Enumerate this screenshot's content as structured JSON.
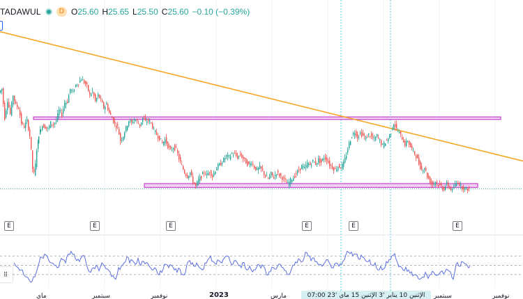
{
  "legend": {
    "symbol": "TADAWUL",
    "interval_badge": "D",
    "open_label": "O",
    "open": "25.60",
    "high_label": "H",
    "high": "25.65",
    "low_label": "L",
    "low": "25.50",
    "close_label": "C",
    "close": "25.60",
    "change": "−0.10 (−0.39%)"
  },
  "colors": {
    "up": "#26a69a",
    "down": "#ef5350",
    "trendline": "#f5a623",
    "zone_border": "#c442c8",
    "zone_fill": "#f3d0f5",
    "oscillator": "#5b6ee1",
    "crosshair": "#4dd0e1"
  },
  "earnings_badge_text": "E",
  "x_axis": {
    "labels": [
      "ماي",
      "سبتمبر",
      "نوفمبر",
      "2023",
      "مارس",
      "سبتمبر",
      "نوفمبر"
    ],
    "bold_label": "2023",
    "cursor_date": "الإثنين 10 يناير '3  الإثنين 15 ماي '23  07:00"
  },
  "chart_data": {
    "type": "candlestick",
    "symbol": "TADAWUL",
    "interval": "D",
    "last_bar": {
      "open": 25.6,
      "high": 25.65,
      "low": 25.5,
      "close": 25.6,
      "change": -0.1,
      "change_pct": -0.39
    },
    "price_path": [
      [
        0,
        33.2
      ],
      [
        4,
        33.5
      ],
      [
        8,
        31.2
      ],
      [
        12,
        32.6
      ],
      [
        16,
        31.5
      ],
      [
        20,
        33.0
      ],
      [
        24,
        32.2
      ],
      [
        28,
        32.0
      ],
      [
        32,
        30.8
      ],
      [
        36,
        30.5
      ],
      [
        40,
        31.0
      ],
      [
        44,
        29.8
      ],
      [
        46,
        28.6
      ],
      [
        48,
        27.2
      ],
      [
        50,
        26.8
      ],
      [
        52,
        27.5
      ],
      [
        55,
        29.3
      ],
      [
        58,
        30.2
      ],
      [
        62,
        30.6
      ],
      [
        66,
        30.5
      ],
      [
        70,
        30.3
      ],
      [
        74,
        30.8
      ],
      [
        78,
        30.7
      ],
      [
        82,
        31.0
      ],
      [
        86,
        31.8
      ],
      [
        90,
        31.5
      ],
      [
        94,
        32.4
      ],
      [
        98,
        32.5
      ],
      [
        102,
        33.5
      ],
      [
        106,
        33.2
      ],
      [
        110,
        33.8
      ],
      [
        114,
        34.0
      ],
      [
        118,
        34.3
      ],
      [
        122,
        34.0
      ],
      [
        126,
        33.7
      ],
      [
        130,
        33.0
      ],
      [
        134,
        33.3
      ],
      [
        138,
        32.5
      ],
      [
        142,
        33.0
      ],
      [
        146,
        32.6
      ],
      [
        150,
        32.0
      ],
      [
        154,
        32.3
      ],
      [
        158,
        31.6
      ],
      [
        162,
        31.2
      ],
      [
        166,
        30.7
      ],
      [
        170,
        30.5
      ],
      [
        174,
        29.4
      ],
      [
        178,
        29.8
      ],
      [
        182,
        30.4
      ],
      [
        186,
        31.0
      ],
      [
        190,
        30.8
      ],
      [
        194,
        31.1
      ],
      [
        198,
        30.9
      ],
      [
        202,
        30.6
      ],
      [
        206,
        31.2
      ],
      [
        210,
        30.9
      ],
      [
        214,
        31.0
      ],
      [
        218,
        30.8
      ],
      [
        222,
        30.2
      ],
      [
        226,
        29.9
      ],
      [
        230,
        29.6
      ],
      [
        234,
        29.2
      ],
      [
        238,
        29.5
      ],
      [
        242,
        29.0
      ],
      [
        246,
        28.6
      ],
      [
        250,
        28.9
      ],
      [
        254,
        28.7
      ],
      [
        258,
        28.0
      ],
      [
        262,
        27.4
      ],
      [
        266,
        26.9
      ],
      [
        270,
        26.6
      ],
      [
        274,
        26.9
      ],
      [
        278,
        26.2
      ],
      [
        282,
        25.8
      ],
      [
        286,
        26.3
      ],
      [
        290,
        26.6
      ],
      [
        294,
        26.9
      ],
      [
        298,
        26.7
      ],
      [
        302,
        27.0
      ],
      [
        306,
        26.6
      ],
      [
        310,
        27.1
      ],
      [
        314,
        27.4
      ],
      [
        318,
        27.6
      ],
      [
        322,
        27.9
      ],
      [
        326,
        28.2
      ],
      [
        330,
        28.1
      ],
      [
        334,
        28.4
      ],
      [
        338,
        28.3
      ],
      [
        342,
        28.1
      ],
      [
        346,
        28.3
      ],
      [
        350,
        28.0
      ],
      [
        354,
        27.7
      ],
      [
        358,
        27.5
      ],
      [
        362,
        27.7
      ],
      [
        366,
        27.3
      ],
      [
        370,
        27.1
      ],
      [
        374,
        27.3
      ],
      [
        378,
        27.0
      ],
      [
        382,
        26.6
      ],
      [
        386,
        26.4
      ],
      [
        390,
        26.8
      ],
      [
        394,
        26.5
      ],
      [
        398,
        26.9
      ],
      [
        402,
        26.7
      ],
      [
        406,
        26.5
      ],
      [
        410,
        26.2
      ],
      [
        414,
        26.0
      ],
      [
        418,
        26.3
      ],
      [
        422,
        26.5
      ],
      [
        426,
        26.8
      ],
      [
        430,
        27.1
      ],
      [
        434,
        27.4
      ],
      [
        438,
        27.2
      ],
      [
        442,
        27.6
      ],
      [
        446,
        27.5
      ],
      [
        450,
        27.8
      ],
      [
        454,
        27.6
      ],
      [
        458,
        27.9
      ],
      [
        462,
        27.7
      ],
      [
        466,
        28.1
      ],
      [
        470,
        27.9
      ],
      [
        474,
        27.5
      ],
      [
        478,
        27.3
      ],
      [
        482,
        27.1
      ],
      [
        486,
        27.4
      ],
      [
        490,
        27.3
      ],
      [
        494,
        27.6
      ],
      [
        498,
        28.3
      ],
      [
        502,
        29.2
      ],
      [
        506,
        29.8
      ],
      [
        510,
        30.1
      ],
      [
        514,
        29.7
      ],
      [
        518,
        30.0
      ],
      [
        522,
        29.8
      ],
      [
        526,
        29.6
      ],
      [
        530,
        29.9
      ],
      [
        534,
        29.7
      ],
      [
        538,
        29.5
      ],
      [
        542,
        29.8
      ],
      [
        546,
        29.4
      ],
      [
        550,
        29.0
      ],
      [
        554,
        29.3
      ],
      [
        558,
        29.6
      ],
      [
        562,
        30.1
      ],
      [
        566,
        30.8
      ],
      [
        570,
        30.3
      ],
      [
        574,
        30.0
      ],
      [
        578,
        29.6
      ],
      [
        582,
        29.1
      ],
      [
        586,
        29.4
      ],
      [
        590,
        28.9
      ],
      [
        594,
        28.6
      ],
      [
        598,
        28.2
      ],
      [
        602,
        27.6
      ],
      [
        606,
        27.1
      ],
      [
        610,
        27.3
      ],
      [
        614,
        26.6
      ],
      [
        618,
        26.2
      ],
      [
        622,
        26.0
      ],
      [
        626,
        26.2
      ],
      [
        630,
        25.9
      ],
      [
        634,
        25.8
      ],
      [
        638,
        25.6
      ],
      [
        642,
        26.0
      ],
      [
        646,
        25.7
      ],
      [
        650,
        25.5
      ],
      [
        654,
        25.9
      ],
      [
        658,
        26.2
      ],
      [
        662,
        25.8
      ],
      [
        666,
        25.7
      ],
      [
        670,
        25.6
      ],
      [
        674,
        25.6
      ]
    ],
    "trendline": {
      "from": [
        0,
        38.0
      ],
      "to": [
        750,
        27.8
      ]
    },
    "resistance_zone": {
      "x_from": 48,
      "x_to": 718,
      "top": 31.28,
      "bottom": 31.08
    },
    "support_zone": {
      "x_from": 207,
      "x_to": 685,
      "top": 26.02,
      "bottom": 25.72
    },
    "last_price_line": 25.6,
    "y_range": [
      23.5,
      40.5
    ],
    "earnings_bars": [
      6,
      129,
      238,
      433,
      500,
      649
    ],
    "crosshair_bars": [
      489,
      560
    ],
    "oscillator": {
      "range": [
        0,
        100
      ],
      "levels": [
        70,
        50,
        30
      ],
      "values": [
        [
          20,
          55
        ],
        [
          26,
          45
        ],
        [
          30,
          40
        ],
        [
          34,
          30
        ],
        [
          38,
          25
        ],
        [
          42,
          18
        ],
        [
          46,
          15
        ],
        [
          50,
          25
        ],
        [
          54,
          45
        ],
        [
          58,
          68
        ],
        [
          62,
          65
        ],
        [
          66,
          72
        ],
        [
          70,
          60
        ],
        [
          74,
          55
        ],
        [
          78,
          50
        ],
        [
          82,
          45
        ],
        [
          86,
          58
        ],
        [
          90,
          62
        ],
        [
          94,
          55
        ],
        [
          98,
          74
        ],
        [
          102,
          80
        ],
        [
          106,
          74
        ],
        [
          110,
          60
        ],
        [
          114,
          58
        ],
        [
          118,
          70
        ],
        [
          122,
          65
        ],
        [
          126,
          42
        ],
        [
          130,
          35
        ],
        [
          134,
          45
        ],
        [
          138,
          50
        ],
        [
          142,
          38
        ],
        [
          146,
          55
        ],
        [
          150,
          48
        ],
        [
          154,
          42
        ],
        [
          158,
          35
        ],
        [
          162,
          28
        ],
        [
          166,
          20
        ],
        [
          170,
          45
        ],
        [
          174,
          48
        ],
        [
          178,
          55
        ],
        [
          182,
          68
        ],
        [
          186,
          55
        ],
        [
          190,
          60
        ],
        [
          194,
          52
        ],
        [
          198,
          65
        ],
        [
          202,
          50
        ],
        [
          206,
          58
        ],
        [
          210,
          56
        ],
        [
          214,
          48
        ],
        [
          218,
          40
        ],
        [
          222,
          45
        ],
        [
          226,
          32
        ],
        [
          230,
          38
        ],
        [
          234,
          42
        ],
        [
          238,
          52
        ],
        [
          242,
          45
        ],
        [
          246,
          50
        ],
        [
          250,
          40
        ],
        [
          254,
          35
        ],
        [
          258,
          42
        ],
        [
          262,
          30
        ],
        [
          266,
          35
        ],
        [
          270,
          58
        ],
        [
          274,
          52
        ],
        [
          278,
          48
        ],
        [
          282,
          55
        ],
        [
          286,
          45
        ],
        [
          290,
          40
        ],
        [
          294,
          55
        ],
        [
          298,
          62
        ],
        [
          302,
          70
        ],
        [
          306,
          58
        ],
        [
          310,
          52
        ],
        [
          314,
          60
        ],
        [
          318,
          55
        ],
        [
          322,
          66
        ],
        [
          326,
          70
        ],
        [
          330,
          58
        ],
        [
          334,
          52
        ],
        [
          338,
          60
        ],
        [
          342,
          50
        ],
        [
          346,
          45
        ],
        [
          350,
          56
        ],
        [
          354,
          40
        ],
        [
          358,
          48
        ],
        [
          362,
          36
        ],
        [
          366,
          40
        ],
        [
          370,
          52
        ],
        [
          374,
          44
        ],
        [
          378,
          48
        ],
        [
          382,
          30
        ],
        [
          386,
          36
        ],
        [
          390,
          46
        ],
        [
          394,
          42
        ],
        [
          398,
          48
        ],
        [
          402,
          52
        ],
        [
          406,
          45
        ],
        [
          410,
          38
        ],
        [
          414,
          30
        ],
        [
          418,
          42
        ],
        [
          422,
          50
        ],
        [
          426,
          55
        ],
        [
          430,
          62
        ],
        [
          434,
          58
        ],
        [
          438,
          78
        ],
        [
          442,
          70
        ],
        [
          446,
          60
        ],
        [
          450,
          66
        ],
        [
          454,
          58
        ],
        [
          458,
          52
        ],
        [
          462,
          48
        ],
        [
          466,
          56
        ],
        [
          470,
          62
        ],
        [
          474,
          50
        ],
        [
          478,
          45
        ],
        [
          482,
          55
        ],
        [
          486,
          48
        ],
        [
          490,
          52
        ],
        [
          494,
          62
        ],
        [
          498,
          80
        ],
        [
          502,
          75
        ],
        [
          506,
          70
        ],
        [
          510,
          74
        ],
        [
          514,
          64
        ],
        [
          518,
          72
        ],
        [
          522,
          66
        ],
        [
          526,
          58
        ],
        [
          530,
          62
        ],
        [
          534,
          50
        ],
        [
          538,
          55
        ],
        [
          542,
          40
        ],
        [
          546,
          48
        ],
        [
          550,
          42
        ],
        [
          554,
          58
        ],
        [
          558,
          62
        ],
        [
          562,
          70
        ],
        [
          566,
          75
        ],
        [
          570,
          56
        ],
        [
          574,
          48
        ],
        [
          578,
          40
        ],
        [
          582,
          46
        ],
        [
          586,
          40
        ],
        [
          590,
          36
        ],
        [
          594,
          30
        ],
        [
          598,
          28
        ],
        [
          602,
          20
        ],
        [
          606,
          25
        ],
        [
          610,
          35
        ],
        [
          614,
          22
        ],
        [
          618,
          30
        ],
        [
          622,
          35
        ],
        [
          626,
          28
        ],
        [
          630,
          32
        ],
        [
          634,
          38
        ],
        [
          638,
          35
        ],
        [
          642,
          40
        ],
        [
          646,
          36
        ],
        [
          650,
          20
        ],
        [
          654,
          52
        ],
        [
          658,
          48
        ],
        [
          662,
          58
        ],
        [
          666,
          54
        ],
        [
          670,
          50
        ],
        [
          674,
          48
        ]
      ]
    }
  }
}
